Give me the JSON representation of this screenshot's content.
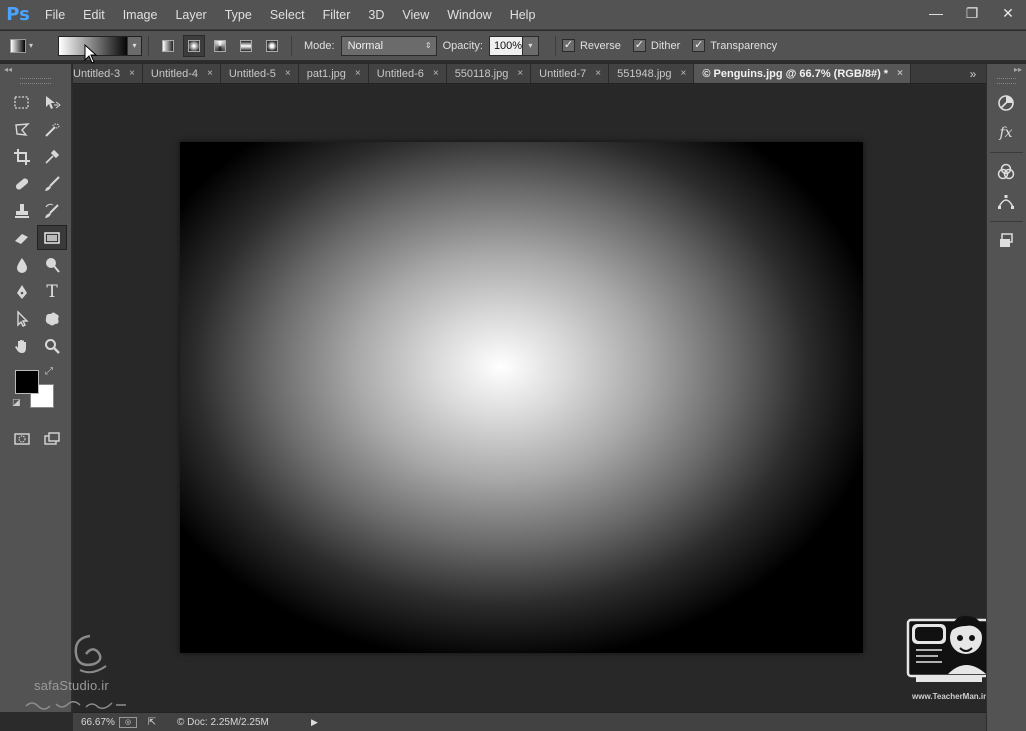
{
  "app": {
    "logo": "Ps"
  },
  "menu": [
    "File",
    "Edit",
    "Image",
    "Layer",
    "Type",
    "Select",
    "Filter",
    "3D",
    "View",
    "Window",
    "Help"
  ],
  "window_controls": {
    "minimize": "—",
    "restore": "❐",
    "close": "✕"
  },
  "options": {
    "mode_label": "Mode:",
    "mode_value": "Normal",
    "opacity_label": "Opacity:",
    "opacity_value": "100%",
    "reverse_label": "Reverse",
    "dither_label": "Dither",
    "transparency_label": "Transparency",
    "check_mark": "✓",
    "gradient_types": [
      "linear",
      "radial",
      "angle",
      "reflected",
      "diamond"
    ],
    "active_gradient_type": "radial"
  },
  "tabs": [
    {
      "label": "Untitled-3",
      "close": "×"
    },
    {
      "label": "Untitled-4",
      "close": "×"
    },
    {
      "label": "Untitled-5",
      "close": "×"
    },
    {
      "label": "pat1.jpg",
      "close": "×"
    },
    {
      "label": "Untitled-6",
      "close": "×"
    },
    {
      "label": "550118.jpg",
      "close": "×"
    },
    {
      "label": "Untitled-7",
      "close": "×"
    },
    {
      "label": "551948.jpg",
      "close": "×"
    },
    {
      "label": "© Penguins.jpg @ 66.7% (RGB/8#) *",
      "close": "×"
    }
  ],
  "tab_overflow": "»",
  "colors": {
    "foreground": "#000000",
    "background": "#ffffff",
    "accent": "#4aa3ff"
  },
  "status": {
    "zoom": "66.67%",
    "doc": "© Doc: 2.25M/2.25M",
    "more_arrow": "▶"
  },
  "watermarks": {
    "left_site": "safaStudio.ir",
    "right_url": "www.TeacherMan.ir"
  },
  "collapse_left": "◂◂",
  "collapse_right": "▸▸"
}
